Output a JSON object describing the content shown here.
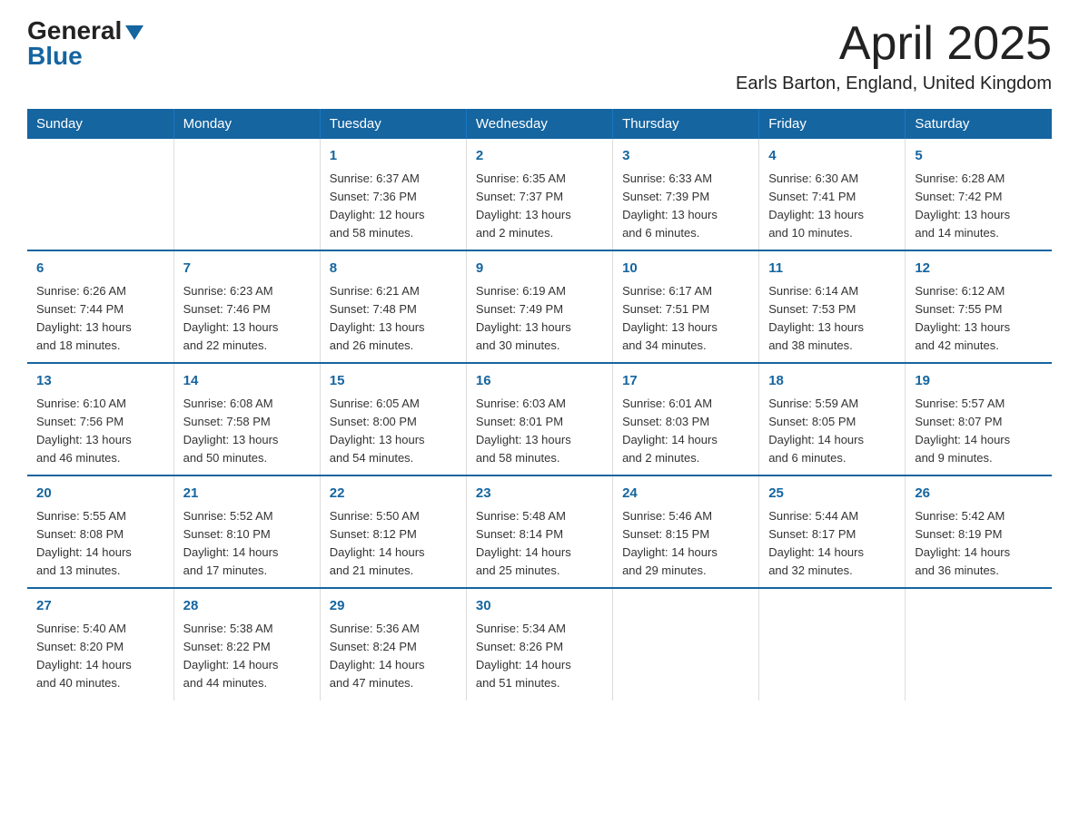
{
  "header": {
    "logo_general": "General",
    "logo_blue": "Blue",
    "title": "April 2025",
    "subtitle": "Earls Barton, England, United Kingdom"
  },
  "days_of_week": [
    "Sunday",
    "Monday",
    "Tuesday",
    "Wednesday",
    "Thursday",
    "Friday",
    "Saturday"
  ],
  "weeks": [
    [
      {
        "day": "",
        "info": ""
      },
      {
        "day": "",
        "info": ""
      },
      {
        "day": "1",
        "info": "Sunrise: 6:37 AM\nSunset: 7:36 PM\nDaylight: 12 hours\nand 58 minutes."
      },
      {
        "day": "2",
        "info": "Sunrise: 6:35 AM\nSunset: 7:37 PM\nDaylight: 13 hours\nand 2 minutes."
      },
      {
        "day": "3",
        "info": "Sunrise: 6:33 AM\nSunset: 7:39 PM\nDaylight: 13 hours\nand 6 minutes."
      },
      {
        "day": "4",
        "info": "Sunrise: 6:30 AM\nSunset: 7:41 PM\nDaylight: 13 hours\nand 10 minutes."
      },
      {
        "day": "5",
        "info": "Sunrise: 6:28 AM\nSunset: 7:42 PM\nDaylight: 13 hours\nand 14 minutes."
      }
    ],
    [
      {
        "day": "6",
        "info": "Sunrise: 6:26 AM\nSunset: 7:44 PM\nDaylight: 13 hours\nand 18 minutes."
      },
      {
        "day": "7",
        "info": "Sunrise: 6:23 AM\nSunset: 7:46 PM\nDaylight: 13 hours\nand 22 minutes."
      },
      {
        "day": "8",
        "info": "Sunrise: 6:21 AM\nSunset: 7:48 PM\nDaylight: 13 hours\nand 26 minutes."
      },
      {
        "day": "9",
        "info": "Sunrise: 6:19 AM\nSunset: 7:49 PM\nDaylight: 13 hours\nand 30 minutes."
      },
      {
        "day": "10",
        "info": "Sunrise: 6:17 AM\nSunset: 7:51 PM\nDaylight: 13 hours\nand 34 minutes."
      },
      {
        "day": "11",
        "info": "Sunrise: 6:14 AM\nSunset: 7:53 PM\nDaylight: 13 hours\nand 38 minutes."
      },
      {
        "day": "12",
        "info": "Sunrise: 6:12 AM\nSunset: 7:55 PM\nDaylight: 13 hours\nand 42 minutes."
      }
    ],
    [
      {
        "day": "13",
        "info": "Sunrise: 6:10 AM\nSunset: 7:56 PM\nDaylight: 13 hours\nand 46 minutes."
      },
      {
        "day": "14",
        "info": "Sunrise: 6:08 AM\nSunset: 7:58 PM\nDaylight: 13 hours\nand 50 minutes."
      },
      {
        "day": "15",
        "info": "Sunrise: 6:05 AM\nSunset: 8:00 PM\nDaylight: 13 hours\nand 54 minutes."
      },
      {
        "day": "16",
        "info": "Sunrise: 6:03 AM\nSunset: 8:01 PM\nDaylight: 13 hours\nand 58 minutes."
      },
      {
        "day": "17",
        "info": "Sunrise: 6:01 AM\nSunset: 8:03 PM\nDaylight: 14 hours\nand 2 minutes."
      },
      {
        "day": "18",
        "info": "Sunrise: 5:59 AM\nSunset: 8:05 PM\nDaylight: 14 hours\nand 6 minutes."
      },
      {
        "day": "19",
        "info": "Sunrise: 5:57 AM\nSunset: 8:07 PM\nDaylight: 14 hours\nand 9 minutes."
      }
    ],
    [
      {
        "day": "20",
        "info": "Sunrise: 5:55 AM\nSunset: 8:08 PM\nDaylight: 14 hours\nand 13 minutes."
      },
      {
        "day": "21",
        "info": "Sunrise: 5:52 AM\nSunset: 8:10 PM\nDaylight: 14 hours\nand 17 minutes."
      },
      {
        "day": "22",
        "info": "Sunrise: 5:50 AM\nSunset: 8:12 PM\nDaylight: 14 hours\nand 21 minutes."
      },
      {
        "day": "23",
        "info": "Sunrise: 5:48 AM\nSunset: 8:14 PM\nDaylight: 14 hours\nand 25 minutes."
      },
      {
        "day": "24",
        "info": "Sunrise: 5:46 AM\nSunset: 8:15 PM\nDaylight: 14 hours\nand 29 minutes."
      },
      {
        "day": "25",
        "info": "Sunrise: 5:44 AM\nSunset: 8:17 PM\nDaylight: 14 hours\nand 32 minutes."
      },
      {
        "day": "26",
        "info": "Sunrise: 5:42 AM\nSunset: 8:19 PM\nDaylight: 14 hours\nand 36 minutes."
      }
    ],
    [
      {
        "day": "27",
        "info": "Sunrise: 5:40 AM\nSunset: 8:20 PM\nDaylight: 14 hours\nand 40 minutes."
      },
      {
        "day": "28",
        "info": "Sunrise: 5:38 AM\nSunset: 8:22 PM\nDaylight: 14 hours\nand 44 minutes."
      },
      {
        "day": "29",
        "info": "Sunrise: 5:36 AM\nSunset: 8:24 PM\nDaylight: 14 hours\nand 47 minutes."
      },
      {
        "day": "30",
        "info": "Sunrise: 5:34 AM\nSunset: 8:26 PM\nDaylight: 14 hours\nand 51 minutes."
      },
      {
        "day": "",
        "info": ""
      },
      {
        "day": "",
        "info": ""
      },
      {
        "day": "",
        "info": ""
      }
    ]
  ]
}
